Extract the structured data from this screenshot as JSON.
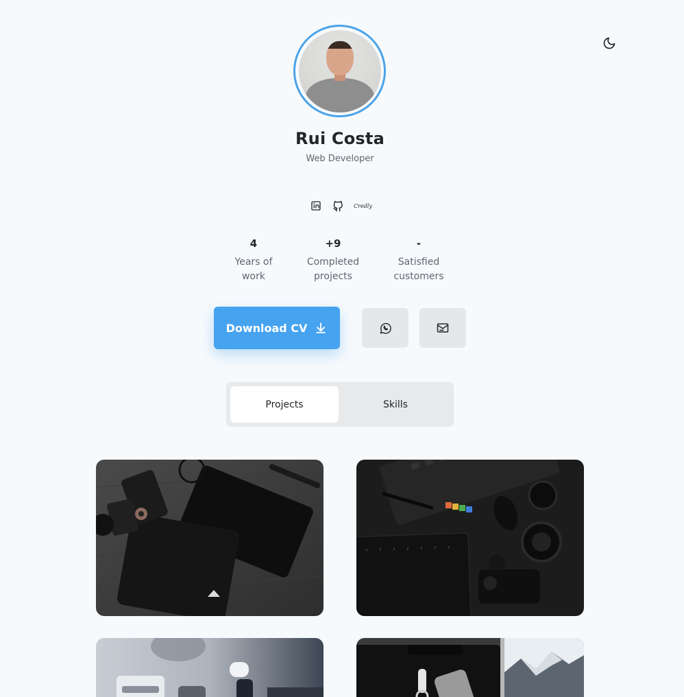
{
  "profile": {
    "name": "Rui Costa",
    "role": "Web Developer"
  },
  "socials": [
    {
      "icon": "linkedin-icon"
    },
    {
      "icon": "github-icon"
    },
    {
      "label": "Credly"
    }
  ],
  "stats": [
    {
      "value": "4",
      "label_line1": "Years of",
      "label_line2": "work"
    },
    {
      "value": "+9",
      "label_line1": "Completed",
      "label_line2": "projects"
    },
    {
      "value": "-",
      "label_line1": "Satisfied",
      "label_line2": "customers"
    }
  ],
  "actions": {
    "download_cv": "Download CV",
    "whatsapp_icon": "whatsapp-icon",
    "email_icon": "mail-icon"
  },
  "tabs": [
    {
      "label": "Projects",
      "active": true
    },
    {
      "label": "Skills",
      "active": false
    }
  ],
  "colors": {
    "accent": "#46a3f0",
    "background": "#f7fafc",
    "button_gray": "#e6e7e9"
  },
  "theme_toggle_icon": "moon-icon"
}
